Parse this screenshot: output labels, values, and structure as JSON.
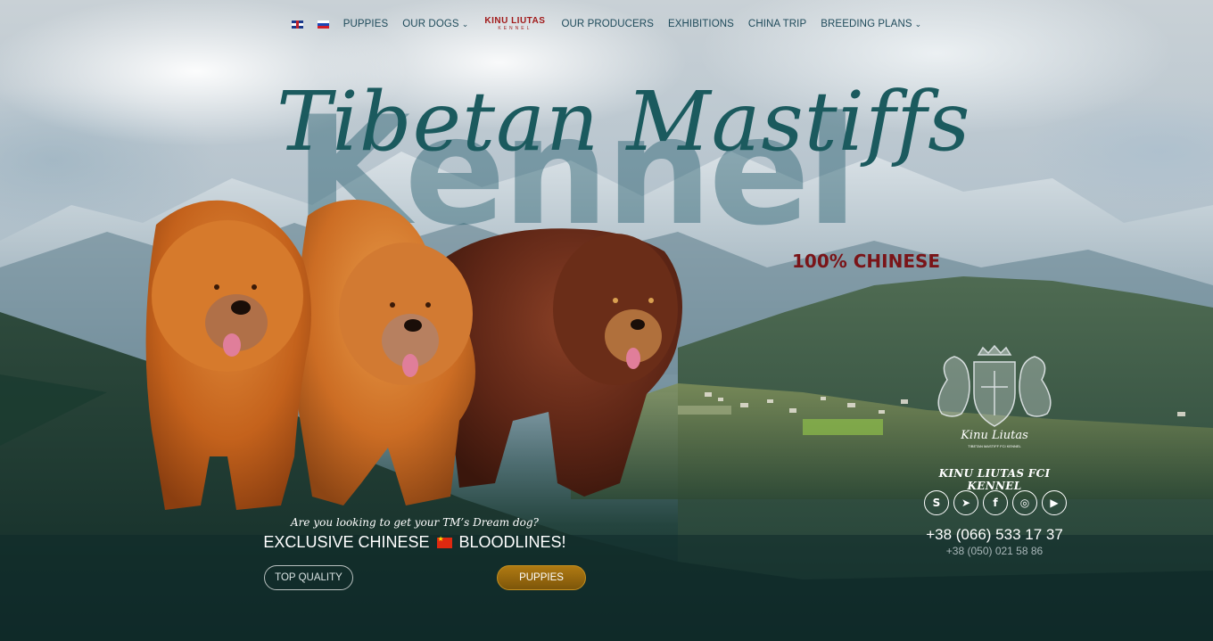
{
  "nav": {
    "flags": [
      "uk-flag-icon",
      "ru-flag-icon"
    ],
    "items": [
      {
        "label": "PUPPIES"
      },
      {
        "label": "OUR DOGS",
        "dropdown": true
      },
      {
        "label": "OUR PRODUCERS"
      },
      {
        "label": "EXHIBITIONS"
      },
      {
        "label": "CHINA TRIP"
      },
      {
        "label": "BREEDING PLANS",
        "dropdown": true
      }
    ],
    "logo_line1": "KINU LIUTAS",
    "logo_line2": "KENNEL",
    "chevron": "⌄"
  },
  "hero": {
    "title": "Tibetan Mastiffs",
    "background_word": "Kennel",
    "subtitle": "100% CHINESE"
  },
  "cta": {
    "tagline": "Are you looking to get your TM’s Dream dog?",
    "bloodlines_pre": "EXCLUSIVE CHINESE",
    "bloodlines_post": "BLOODLINES!",
    "btn_quality": "TOP QUALITY",
    "btn_puppies": "PUPPIES"
  },
  "sidebar": {
    "crest_text": "Kinu Liutas",
    "crest_subtext": "TIBETAN MASTIFF FCI KENNEL",
    "kennel_name": "KINU LIUTAS FCI KENNEL",
    "socials": [
      {
        "icon": "skype-icon",
        "glyph": "S"
      },
      {
        "icon": "telegram-icon",
        "glyph": "➤"
      },
      {
        "icon": "facebook-icon",
        "glyph": "f"
      },
      {
        "icon": "instagram-icon",
        "glyph": "◎"
      },
      {
        "icon": "youtube-icon",
        "glyph": "▶"
      }
    ],
    "phone_primary": "+38 (066) 533 17 37",
    "phone_secondary": "+38 (050) 021 58 86"
  },
  "colors": {
    "title_teal": "#1b5a5e",
    "subtitle_red": "#7a1418",
    "nav_text": "#1e4a5a",
    "accent_gold": "#b07a12"
  }
}
